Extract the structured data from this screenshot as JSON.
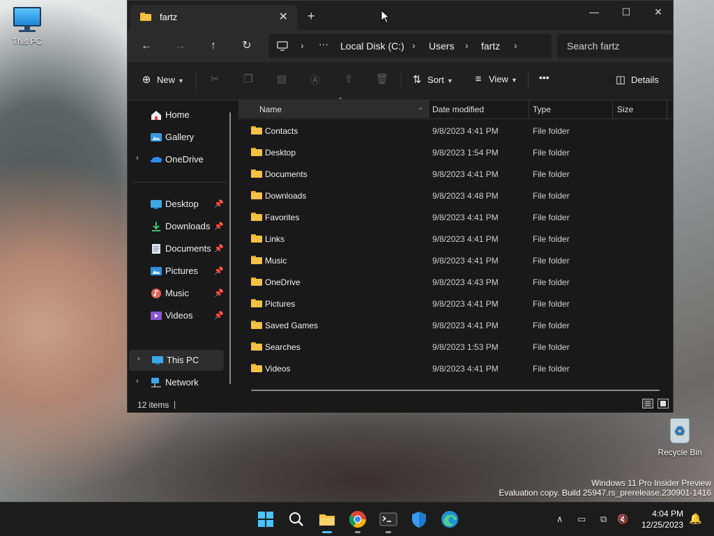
{
  "desktop": {
    "icons": [
      {
        "label": "This PC",
        "icon": "this-pc-icon"
      },
      {
        "label": "Recycle Bin",
        "icon": "recycle-bin-icon"
      }
    ],
    "watermark": {
      "line1": "Windows 11 Pro Insider Preview",
      "line2": "Evaluation copy. Build 25947.rs_prerelease.230901-1416"
    }
  },
  "explorer": {
    "tab_title": "fartz",
    "address": {
      "overflow": "···",
      "segments": [
        "Local Disk (C:)",
        "Users",
        "fartz"
      ]
    },
    "search_placeholder": "Search fartz",
    "toolbar": {
      "new_label": "New",
      "sort_label": "Sort",
      "view_label": "View",
      "more_label": "•••",
      "details_label": "Details"
    },
    "sidebar": {
      "top": [
        {
          "label": "Home",
          "icon": "home-icon"
        },
        {
          "label": "Gallery",
          "icon": "gallery-icon"
        },
        {
          "label": "OneDrive",
          "icon": "onedrive-icon"
        }
      ],
      "pinned": [
        {
          "label": "Desktop",
          "icon": "desktop-folder-icon"
        },
        {
          "label": "Downloads",
          "icon": "downloads-icon"
        },
        {
          "label": "Documents",
          "icon": "documents-icon"
        },
        {
          "label": "Pictures",
          "icon": "pictures-icon"
        },
        {
          "label": "Music",
          "icon": "music-icon"
        },
        {
          "label": "Videos",
          "icon": "videos-icon"
        }
      ],
      "bottom": [
        {
          "label": "This PC",
          "icon": "this-pc-icon"
        },
        {
          "label": "Network",
          "icon": "network-icon"
        }
      ]
    },
    "columns": {
      "name": "Name",
      "date": "Date modified",
      "type": "Type",
      "size": "Size"
    },
    "files": [
      {
        "name": "Contacts",
        "date": "9/8/2023 4:41 PM",
        "type": "File folder"
      },
      {
        "name": "Desktop",
        "date": "9/8/2023 1:54 PM",
        "type": "File folder"
      },
      {
        "name": "Documents",
        "date": "9/8/2023 4:41 PM",
        "type": "File folder"
      },
      {
        "name": "Downloads",
        "date": "9/8/2023 4:48 PM",
        "type": "File folder"
      },
      {
        "name": "Favorites",
        "date": "9/8/2023 4:41 PM",
        "type": "File folder"
      },
      {
        "name": "Links",
        "date": "9/8/2023 4:41 PM",
        "type": "File folder"
      },
      {
        "name": "Music",
        "date": "9/8/2023 4:41 PM",
        "type": "File folder"
      },
      {
        "name": "OneDrive",
        "date": "9/8/2023 4:43 PM",
        "type": "File folder"
      },
      {
        "name": "Pictures",
        "date": "9/8/2023 4:41 PM",
        "type": "File folder"
      },
      {
        "name": "Saved Games",
        "date": "9/8/2023 4:41 PM",
        "type": "File folder"
      },
      {
        "name": "Searches",
        "date": "9/8/2023 1:53 PM",
        "type": "File folder"
      },
      {
        "name": "Videos",
        "date": "9/8/2023 4:41 PM",
        "type": "File folder"
      }
    ],
    "status": {
      "item_count": "12 items"
    }
  },
  "taskbar": {
    "time": "4:04 PM",
    "date": "12/25/2023"
  },
  "colors": {
    "accent": "#4cc2ff",
    "folder": "#f4c242",
    "window_bg": "#191919"
  }
}
